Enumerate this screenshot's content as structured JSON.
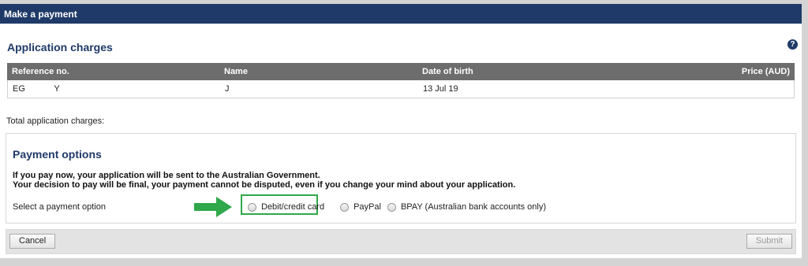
{
  "window_title": "Make a payment",
  "application_charges": {
    "title": "Application charges",
    "help_icon": "?",
    "columns": [
      "Reference no.",
      "Name",
      "Date of birth",
      "Price (AUD)"
    ],
    "rows": [
      {
        "reference": "EG            Y",
        "name": "J",
        "dob": "13 Jul 19",
        "price": ""
      }
    ],
    "total_label": "Total application charges:"
  },
  "payment_options": {
    "title": "Payment options",
    "notice_line1": "If you pay now, your application will be sent to the Australian Government.",
    "notice_line2": "Your decision to pay will be final, your payment cannot be disputed, even if you change your mind about your application.",
    "select_label": "Select a payment option",
    "options": [
      {
        "label": "Debit/credit card",
        "selected": false
      },
      {
        "label": "PayPal",
        "selected": false
      },
      {
        "label": "BPAY (Australian bank accounts only)",
        "selected": false
      }
    ],
    "highlight_color": "#2fa84a"
  },
  "buttons": {
    "cancel": "Cancel",
    "submit": "Submit"
  },
  "colors": {
    "header": "#1f3a68",
    "table_header": "#6d6d6d"
  }
}
